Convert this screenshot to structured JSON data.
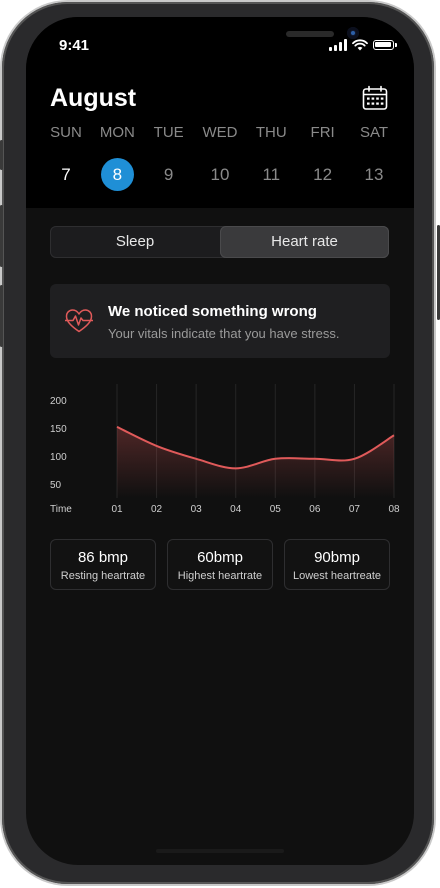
{
  "status_bar": {
    "time": "9:41"
  },
  "header": {
    "month": "August",
    "calendar_icon": "calendar-icon"
  },
  "week": {
    "days": [
      "SUN",
      "MON",
      "TUE",
      "WED",
      "THU",
      "FRI",
      "SAT"
    ],
    "dates": [
      "7",
      "8",
      "9",
      "10",
      "11",
      "12",
      "13"
    ],
    "selected_index": 1
  },
  "tabs": {
    "sleep": "Sleep",
    "heart_rate": "Heart rate",
    "active": "heart_rate"
  },
  "alert": {
    "icon": "heart-pulse-icon",
    "title": "We noticed something wrong",
    "message": "Your vitals indicate that you have stress.",
    "color": "#e05a5a"
  },
  "chart_data": {
    "type": "area",
    "x_label": "Time",
    "x": [
      "01",
      "02",
      "03",
      "04",
      "05",
      "06",
      "07",
      "08"
    ],
    "y_ticks": [
      "200",
      "150",
      "100",
      "50"
    ],
    "ylim": [
      50,
      200
    ],
    "values": [
      152,
      118,
      95,
      78,
      95,
      95,
      95,
      137
    ],
    "color": "#e05a5a",
    "grid": "vertical lines"
  },
  "stats": [
    {
      "value": "86 bmp",
      "label": "Resting heartrate"
    },
    {
      "value": "60bmp",
      "label": "Highest heartrate"
    },
    {
      "value": "90bmp",
      "label": "Lowest heartreate"
    }
  ],
  "colors": {
    "accent": "#1f8fd6",
    "background": "#101010",
    "header": "#000000",
    "card": "#1f1f21"
  }
}
